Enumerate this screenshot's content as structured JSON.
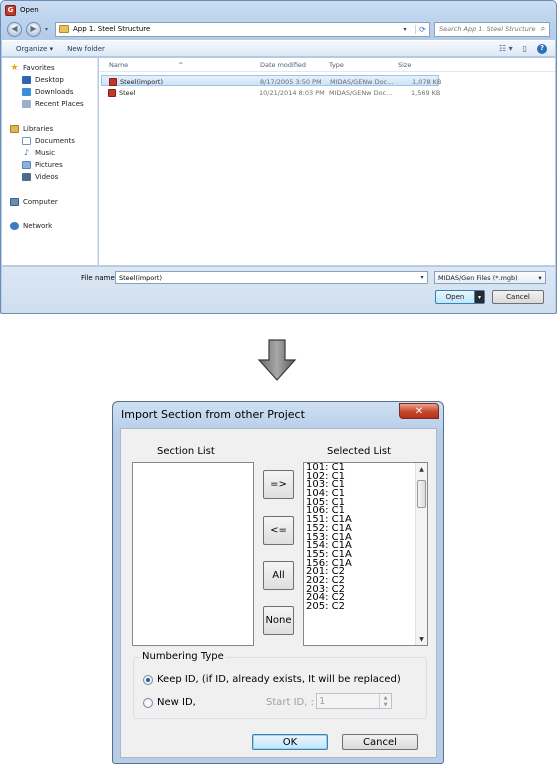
{
  "open_dialog": {
    "title": "Open",
    "address": {
      "path": "App 1. Steel Structure",
      "search_placeholder": "Search App 1. Steel Structure"
    },
    "toolbar": {
      "organize_label": "Organize ▾",
      "new_folder_label": "New folder"
    },
    "nav": {
      "favorites": "Favorites",
      "desktop": "Desktop",
      "downloads": "Downloads",
      "recent_places": "Recent Places",
      "libraries": "Libraries",
      "documents": "Documents",
      "music": "Music",
      "pictures": "Pictures",
      "videos": "Videos",
      "computer": "Computer",
      "network": "Network"
    },
    "columns": {
      "name": "Name",
      "date_modified": "Date modified",
      "type": "Type",
      "size": "Size"
    },
    "files": [
      {
        "name": "Steel(import)",
        "date": "8/17/2005 3:50 PM",
        "type": "MIDAS/GENw Doc...",
        "size": "1,078 KB"
      },
      {
        "name": "Steel",
        "date": "10/21/2014 8:03 PM",
        "type": "MIDAS/GENw Doc...",
        "size": "1,569 KB"
      }
    ],
    "file_name_label": "File name:",
    "file_name_value": "Steel(import)",
    "file_type": "MIDAS/Gen Files (*.mgb)",
    "open_label": "Open",
    "cancel_label": "Cancel"
  },
  "import_dialog": {
    "title": "Import Section from other Project",
    "close_label": "✕",
    "section_list_label": "Section List",
    "selected_list_label": "Selected List",
    "selected_items": [
      "101: C1",
      "102: C1",
      "103: C1",
      "104: C1",
      "105: C1",
      "106: C1",
      "151: C1A",
      "152: C1A",
      "153: C1A",
      "154: C1A",
      "155: C1A",
      "156: C1A",
      "201: C2",
      "202: C2",
      "203: C2",
      "204: C2",
      "205: C2"
    ],
    "buttons": {
      "add": "=>",
      "remove": "<=",
      "all": "All",
      "none": "None",
      "ok": "OK",
      "cancel": "Cancel"
    },
    "numbering": {
      "legend": "Numbering Type",
      "keep_id_label": "Keep ID, (if ID, already exists, It will be replaced)",
      "new_id_label": "New ID,",
      "selected": "keep_id",
      "start_id_label": "Start ID, :",
      "start_id_value": "1"
    }
  }
}
